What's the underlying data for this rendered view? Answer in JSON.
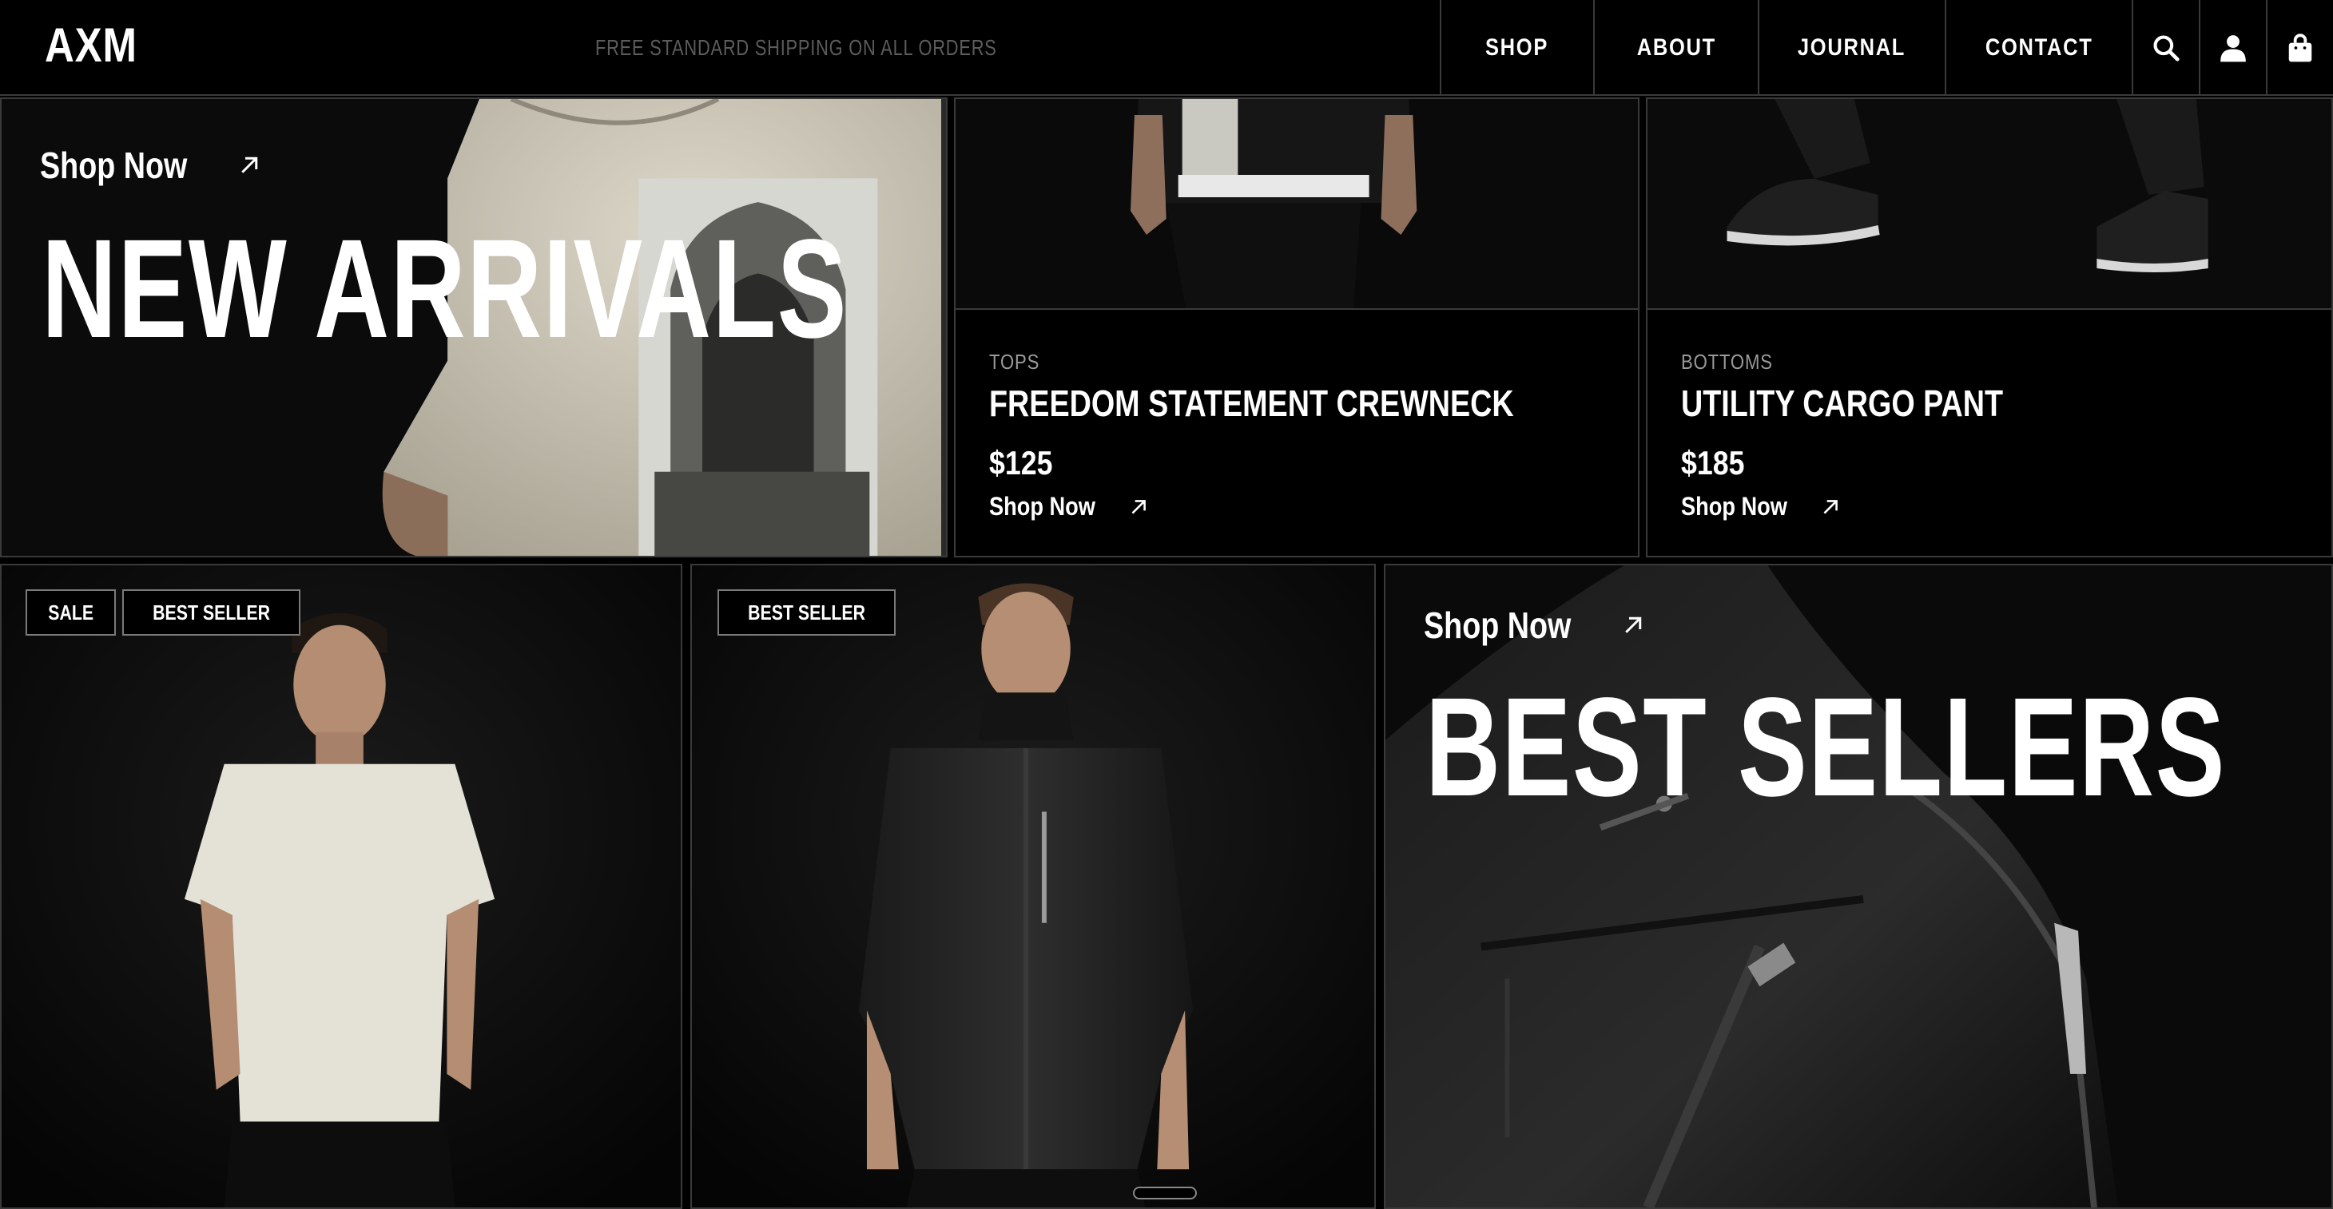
{
  "header": {
    "logo": "AXM",
    "promo": "FREE STANDARD SHIPPING ON ALL ORDERS",
    "nav": [
      {
        "label": "SHOP"
      },
      {
        "label": "ABOUT"
      },
      {
        "label": "JOURNAL"
      },
      {
        "label": "CONTACT"
      }
    ],
    "icons": [
      "search-icon",
      "account-icon",
      "shopping-bag-icon"
    ]
  },
  "new_arrivals": {
    "shop_now": "Shop Now",
    "title": "NEW ARRIVALS"
  },
  "products": [
    {
      "category": "TOPS",
      "name": "FREEDOM STATEMENT CREWNECK",
      "price": "$125",
      "cta": "Shop Now"
    },
    {
      "category": "BOTTOMS",
      "name": "UTILITY CARGO PANT",
      "price": "$185",
      "cta": "Shop Now"
    }
  ],
  "featured": [
    {
      "badges": [
        "SALE",
        "BEST SELLER"
      ]
    },
    {
      "badges": [
        "BEST SELLER"
      ]
    }
  ],
  "best_sellers": {
    "shop_now": "Shop Now",
    "title": "BEST SELLERS"
  },
  "colors": {
    "background": "#000000",
    "text": "#ffffff",
    "border": "#3a3a3a",
    "muted": "#9a9a9a"
  }
}
